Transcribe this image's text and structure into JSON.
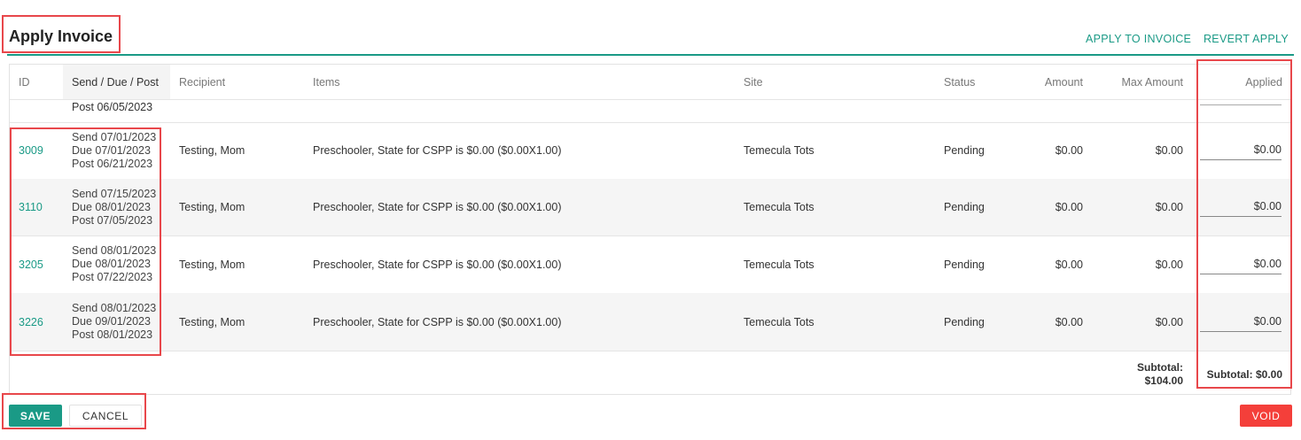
{
  "title": "Apply Invoice",
  "header_links": {
    "apply": "APPLY TO INVOICE",
    "revert": "REVERT APPLY"
  },
  "columns": {
    "id": "ID",
    "dates": "Send / Due / Post",
    "recipient": "Recipient",
    "items": "Items",
    "site": "Site",
    "status": "Status",
    "amount": "Amount",
    "max_amount": "Max Amount",
    "applied": "Applied"
  },
  "partial_row": {
    "post": "Post 06/05/2023"
  },
  "rows": [
    {
      "id": "3009",
      "send": "Send 07/01/2023",
      "due": "Due 07/01/2023",
      "post": "Post 06/21/2023",
      "recipient": "Testing, Mom",
      "items": "Preschooler, State for CSPP is $0.00 ($0.00X1.00)",
      "site": "Temecula Tots",
      "status": "Pending",
      "amount": "$0.00",
      "max_amount": "$0.00",
      "applied": "$0.00"
    },
    {
      "id": "3110",
      "send": "Send 07/15/2023",
      "due": "Due 08/01/2023",
      "post": "Post 07/05/2023",
      "recipient": "Testing, Mom",
      "items": "Preschooler, State for CSPP is $0.00 ($0.00X1.00)",
      "site": "Temecula Tots",
      "status": "Pending",
      "amount": "$0.00",
      "max_amount": "$0.00",
      "applied": "$0.00"
    },
    {
      "id": "3205",
      "send": "Send 08/01/2023",
      "due": "Due 08/01/2023",
      "post": "Post 07/22/2023",
      "recipient": "Testing, Mom",
      "items": "Preschooler, State for CSPP is $0.00 ($0.00X1.00)",
      "site": "Temecula Tots",
      "status": "Pending",
      "amount": "$0.00",
      "max_amount": "$0.00",
      "applied": "$0.00"
    },
    {
      "id": "3226",
      "send": "Send 08/01/2023",
      "due": "Due 09/01/2023",
      "post": "Post 08/01/2023",
      "recipient": "Testing, Mom",
      "items": "Preschooler, State for CSPP is $0.00 ($0.00X1.00)",
      "site": "Temecula Tots",
      "status": "Pending",
      "amount": "$0.00",
      "max_amount": "$0.00",
      "applied": "$0.00"
    }
  ],
  "footer": {
    "subtotal_label": "Subtotal:",
    "subtotal_value": "$104.00",
    "applied_subtotal": "Subtotal: $0.00"
  },
  "buttons": {
    "save": "SAVE",
    "cancel": "CANCEL",
    "void": "VOID"
  },
  "colors": {
    "accent": "#1a9a86",
    "danger": "#f43f3a",
    "annotation": "#e8474b"
  }
}
